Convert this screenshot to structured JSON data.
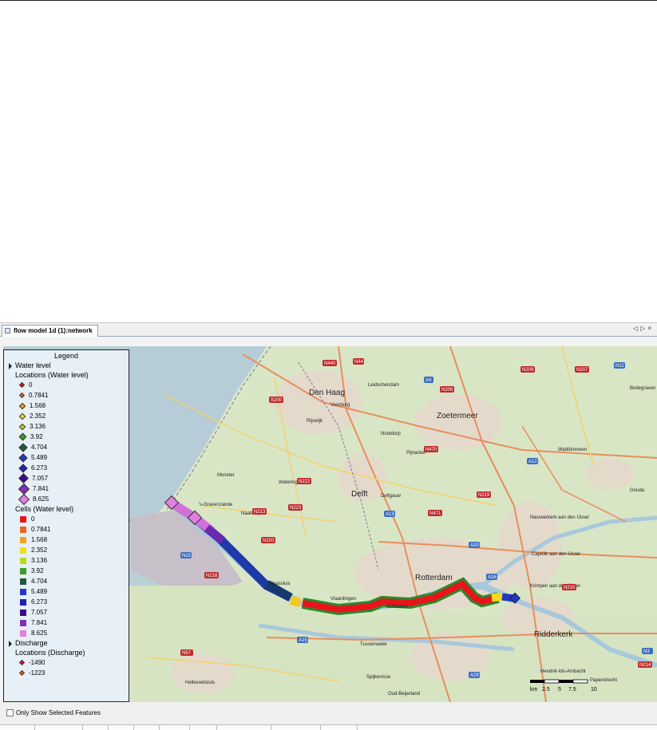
{
  "tab": {
    "title": "flow model 1d (1):network",
    "nav_left": "◁",
    "nav_right": "▷",
    "close": "×"
  },
  "legend": {
    "title": "Legend",
    "water_level_group": "Water level",
    "locations_water_label": "Locations (Water level)",
    "locations_water": [
      {
        "value": "0",
        "color": "#e8141c",
        "size": 5
      },
      {
        "value": "0.7841",
        "color": "#f0641c",
        "size": 5
      },
      {
        "value": "1.568",
        "color": "#f5a020",
        "size": 6
      },
      {
        "value": "2.352",
        "color": "#f5d820",
        "size": 6
      },
      {
        "value": "3.136",
        "color": "#c0d820",
        "size": 6
      },
      {
        "value": "3.92",
        "color": "#3c9c28",
        "size": 7
      },
      {
        "value": "4.704",
        "color": "#1c5c3c",
        "size": 8
      },
      {
        "value": "5.489",
        "color": "#2038c8",
        "size": 8
      },
      {
        "value": "6.273",
        "color": "#2020b8",
        "size": 8
      },
      {
        "value": "7.057",
        "color": "#380c88",
        "size": 9
      },
      {
        "value": "7.841",
        "color": "#8030b0",
        "size": 10
      },
      {
        "value": "8.625",
        "color": "#e080e0",
        "size": 10
      }
    ],
    "cells_water_label": "Cells (Water level)",
    "cells_water": [
      {
        "value": "0",
        "color": "#e8141c"
      },
      {
        "value": "0.7841",
        "color": "#f0641c"
      },
      {
        "value": "1.568",
        "color": "#f5a020"
      },
      {
        "value": "2.352",
        "color": "#f5d820"
      },
      {
        "value": "3.136",
        "color": "#c0d820"
      },
      {
        "value": "3.92",
        "color": "#3c9c28"
      },
      {
        "value": "4.704",
        "color": "#1c5c3c"
      },
      {
        "value": "5.489",
        "color": "#2038c8"
      },
      {
        "value": "6.273",
        "color": "#2020b8"
      },
      {
        "value": "7.057",
        "color": "#380c88"
      },
      {
        "value": "7.841",
        "color": "#8030b0"
      },
      {
        "value": "8.625",
        "color": "#e080e0"
      }
    ],
    "discharge_group": "Discharge",
    "locations_discharge_label": "Locations (Discharge)",
    "locations_discharge": [
      {
        "value": "-1490",
        "color": "#e8141c",
        "size": 5
      },
      {
        "value": "-1223",
        "color": "#f0641c",
        "size": 5
      }
    ]
  },
  "map": {
    "place_labels": [
      "Den Haag",
      "Leidschendam",
      "Zoetermeer",
      "Voorburg",
      "Rijswijk",
      "Nootdorp",
      "Monster",
      "Wateringen",
      "Pijnacker",
      "'s-Gravenzande",
      "Naaldwijk",
      "Delft",
      "Delfgauw",
      "Waddinxveen",
      "Gouda",
      "Bodegraven",
      "Nieuwerkerk aan den IJssel",
      "Capelle aan den IJssel",
      "Rotterdam",
      "Krimpen aan den IJssel",
      "Maassluis",
      "Vlaardingen",
      "Schiedam",
      "Ridderkerk",
      "Tussenwater",
      "Spijkenisse",
      "Hellevoetsluis",
      "Oud-Beijerland",
      "Hendrik-Ido-Ambacht",
      "Papendrecht"
    ],
    "road_labels": [
      "N440",
      "N44",
      "A4",
      "N206",
      "N209",
      "N207",
      "N11",
      "S200",
      "N470",
      "N222",
      "N223",
      "N213",
      "N220",
      "A13",
      "N471",
      "N219",
      "A20",
      "A12",
      "A16",
      "N210",
      "N15",
      "N218",
      "A15",
      "N57",
      "A29",
      "N3",
      "N214"
    ],
    "scale_labels": [
      "km",
      "2.5",
      "5",
      "7.5",
      "10"
    ],
    "colors": {
      "land": "#d8e8c8",
      "water": "#aac8d8",
      "sea": "#b4ccd8",
      "urban": "#e6dccc",
      "road_major": "#e89060",
      "road_minor": "#f8d070"
    }
  },
  "bottom": {
    "only_show_selected": "Only Show Selected Features"
  }
}
